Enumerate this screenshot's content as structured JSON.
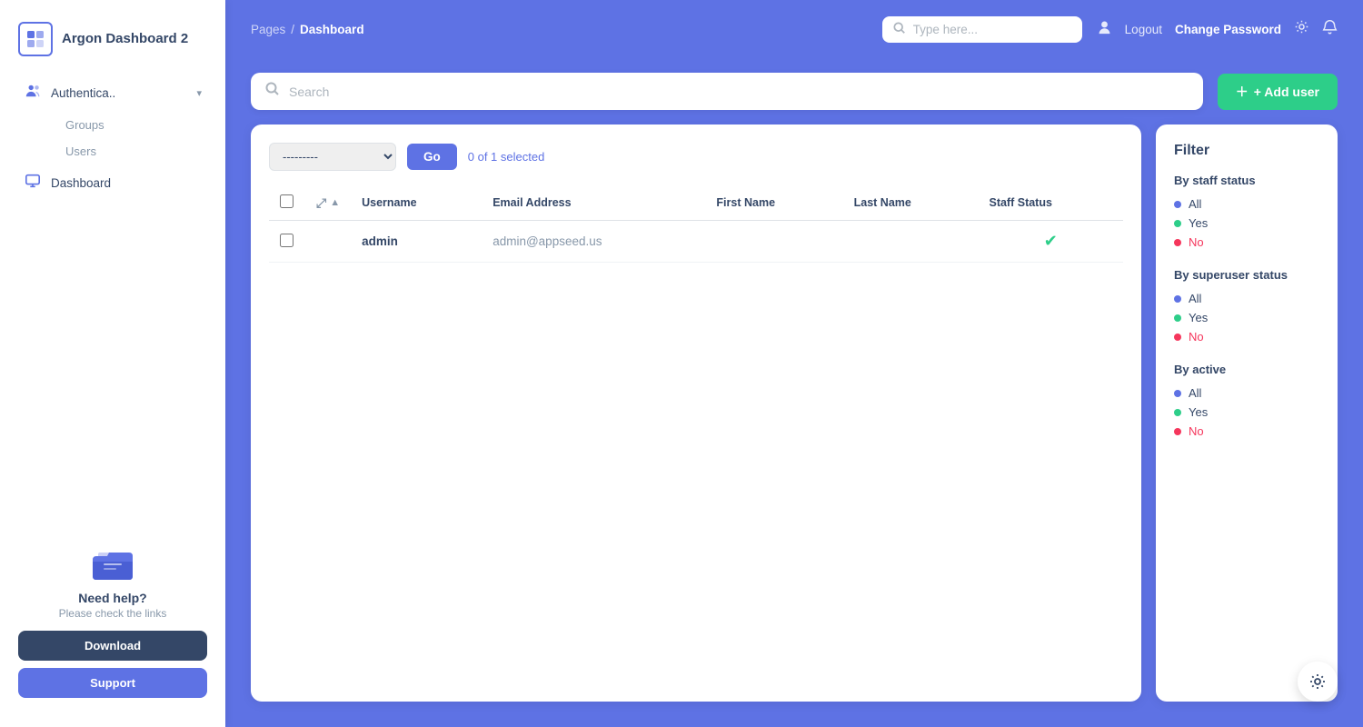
{
  "sidebar": {
    "logo_text": "Argon Dashboard 2",
    "nav_items": [
      {
        "label": "Authentica..",
        "icon": "👥",
        "has_chevron": true
      },
      {
        "label": "Groups",
        "sub": true
      },
      {
        "label": "Users",
        "sub": true
      },
      {
        "label": "Dashboard",
        "icon": "🖥",
        "has_chevron": false
      }
    ],
    "help": {
      "title": "Need help?",
      "subtitle": "Please check the links"
    },
    "download_label": "Download",
    "support_label": "Support"
  },
  "header": {
    "breadcrumb_pages": "Pages",
    "breadcrumb_sep": "/",
    "breadcrumb_current": "Dashboard",
    "search_placeholder": "Type here...",
    "logout_label": "Logout",
    "change_password_label": "Change Password"
  },
  "content": {
    "search_placeholder": "Search",
    "add_user_label": "+ Add user",
    "action_placeholder": "---------",
    "go_label": "Go",
    "selected_count": "0 of 1 selected"
  },
  "table": {
    "columns": [
      "",
      "",
      "Username",
      "Email Address",
      "First Name",
      "Last Name",
      "Staff Status"
    ],
    "rows": [
      {
        "username": "admin",
        "email": "admin@appseed.us",
        "first_name": "",
        "last_name": "",
        "staff_status": true
      }
    ]
  },
  "filter": {
    "title": "Filter",
    "sections": [
      {
        "label": "By staff status",
        "items": [
          "All",
          "Yes",
          "No"
        ]
      },
      {
        "label": "By superuser status",
        "items": [
          "All",
          "Yes",
          "No"
        ]
      },
      {
        "label": "By active",
        "items": [
          "All",
          "Yes",
          "No"
        ]
      }
    ]
  },
  "icons": {
    "search": "🔍",
    "user": "👤",
    "gear": "⚙",
    "bell": "🔔",
    "check": "✔",
    "sort_asc": "▲",
    "resize": "⤢"
  }
}
